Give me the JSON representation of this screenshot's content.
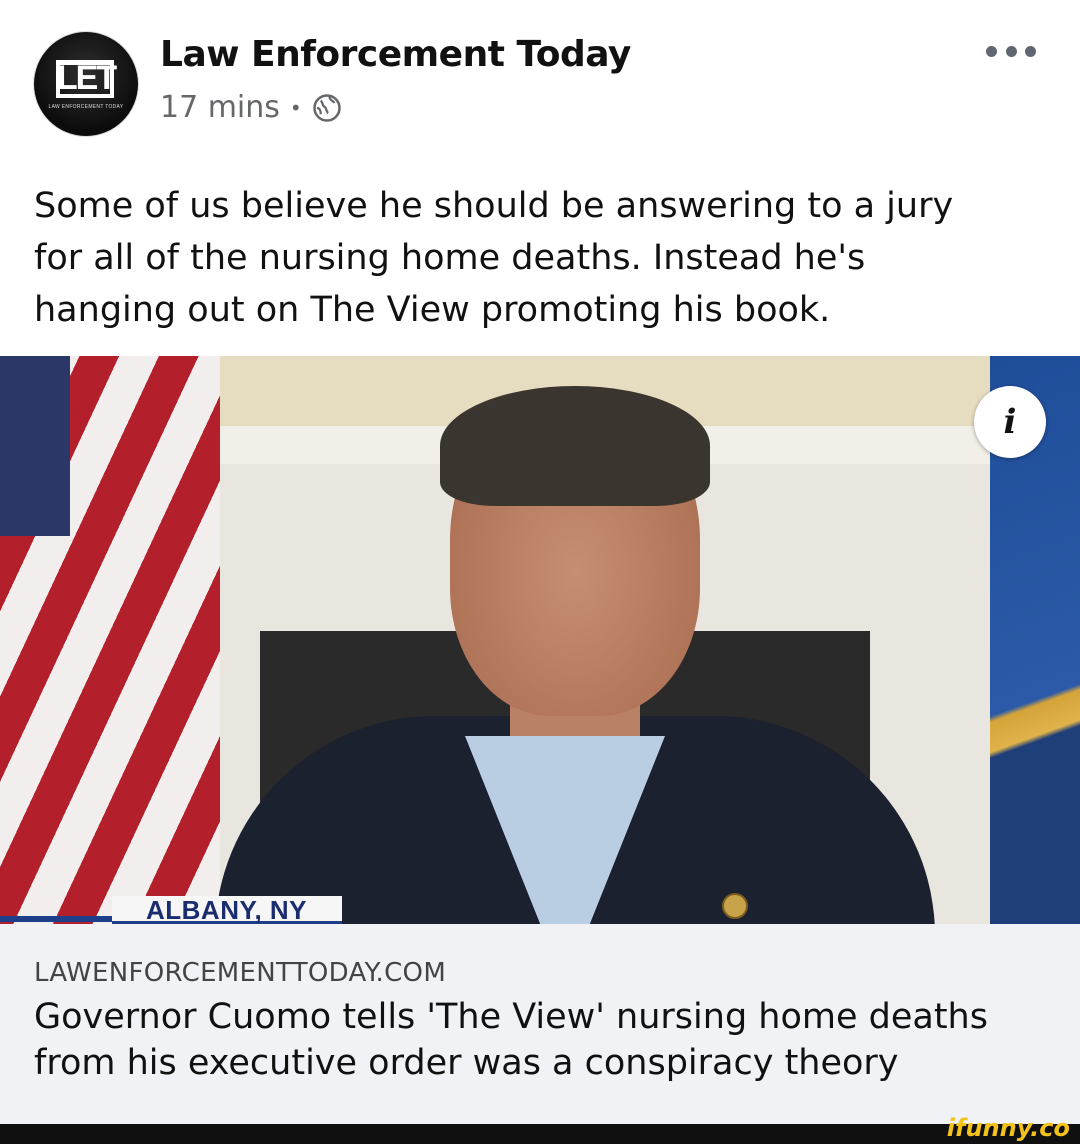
{
  "header": {
    "page_name": "Law Enforcement Today",
    "timestamp": "17 mins",
    "separator": "•",
    "logo_letters": "LET",
    "logo_subtext": "LAW ENFORCEMENT TODAY",
    "privacy_icon": "globe-icon",
    "menu_icon": "more-horizontal-icon"
  },
  "post": {
    "caption": "Some of us believe he should be answering to a jury\nfor all of the nursing home deaths.  Instead he's\nhanging out on The View promoting his book."
  },
  "media": {
    "chyron": "ALBANY, NY",
    "info_label": "i"
  },
  "link_preview": {
    "domain": "LAWENFORCEMENTTODAY.COM",
    "title": "Governor Cuomo tells 'The View' nursing home deaths from his executive order was a conspiracy theory"
  },
  "watermark": "ifunny.co",
  "colors": {
    "meta_gray": "#65676b",
    "link_bg": "#f0f2f5",
    "watermark_yellow": "#f3c21b"
  }
}
